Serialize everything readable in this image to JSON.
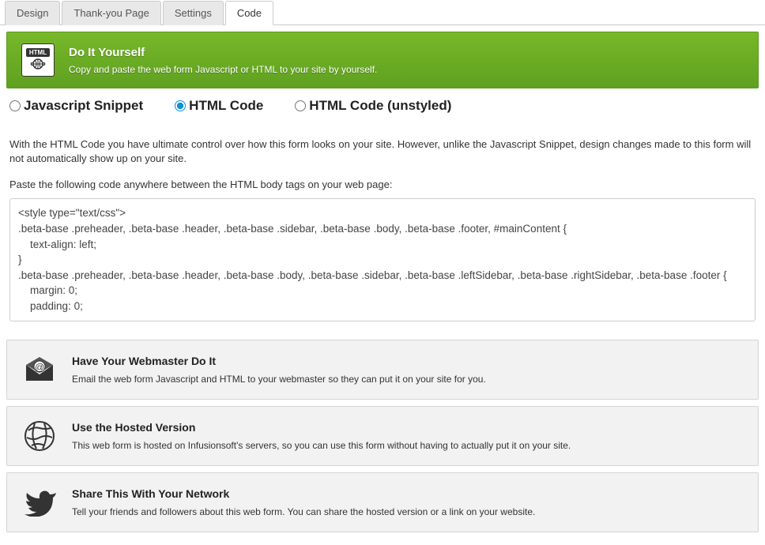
{
  "tabs": {
    "items": [
      {
        "label": "Design"
      },
      {
        "label": "Thank-you Page"
      },
      {
        "label": "Settings"
      },
      {
        "label": "Code"
      }
    ],
    "active_index": 3
  },
  "banner": {
    "icon_label": "HTML",
    "title": "Do It Yourself",
    "description": "Copy and paste the web form Javascript or HTML to your site by yourself."
  },
  "radios": {
    "js": "Javascript Snippet",
    "html": "HTML Code",
    "unstyled": "HTML Code (unstyled)"
  },
  "description_text": "With the HTML Code you have ultimate control over how this form looks on your site. However, unlike the Javascript Snippet, design changes made to this form will not automatically show up on your site.",
  "paste_instruction": "Paste the following code anywhere between the HTML body tags on your web page:",
  "code": "<style type=\"text/css\">\n.beta-base .preheader, .beta-base .header, .beta-base .sidebar, .beta-base .body, .beta-base .footer, #mainContent {\n    text-align: left;\n}\n.beta-base .preheader, .beta-base .header, .beta-base .body, .beta-base .sidebar, .beta-base .leftSidebar, .beta-base .rightSidebar, .beta-base .footer {\n    margin: 0;\n    padding: 0;",
  "sections": {
    "webmaster": {
      "title": "Have Your Webmaster Do It",
      "description": "Email the web form Javascript and HTML to your webmaster so they can put it on your site for you."
    },
    "hosted": {
      "title": "Use the Hosted Version",
      "description": "This web form is hosted on Infusionsoft's servers, so you can use this form without having to actually put it on your site."
    },
    "share": {
      "title": "Share This With Your Network",
      "description": "Tell your friends and followers about this web form. You can share the hosted version or a link on your website."
    }
  }
}
